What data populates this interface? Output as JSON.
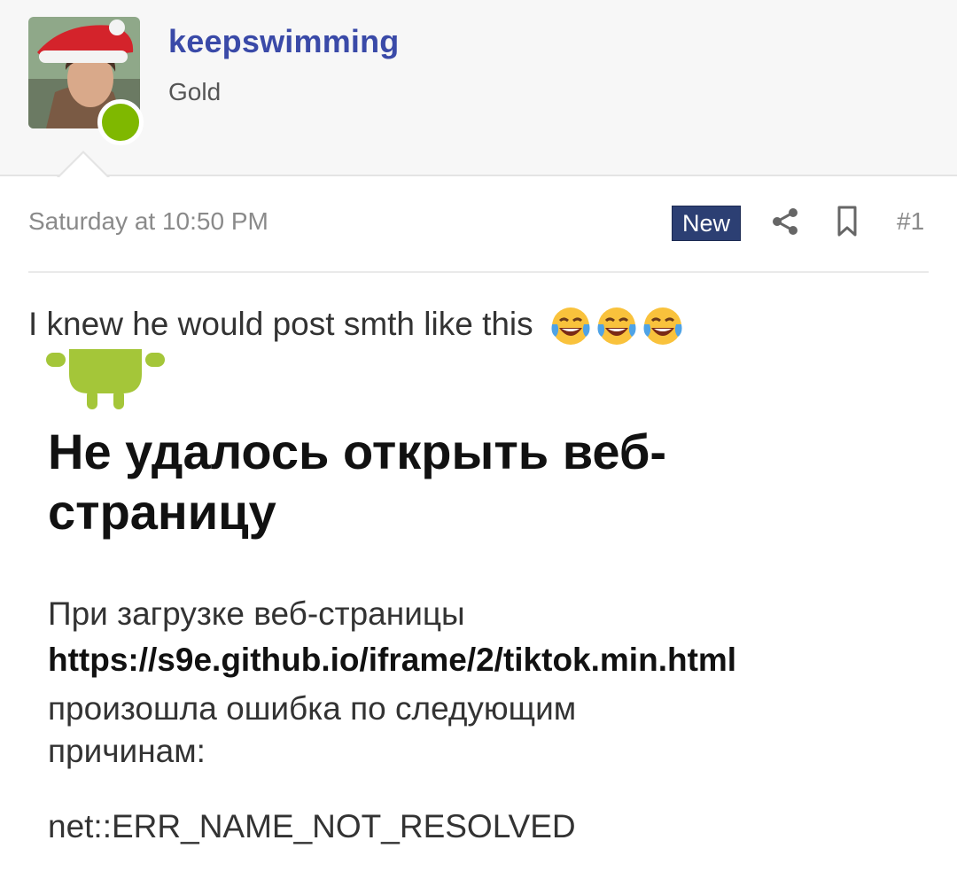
{
  "user": {
    "name": "keepswimming",
    "title": "Gold",
    "online": true
  },
  "post": {
    "date": "Saturday at 10:50 PM",
    "badge": "New",
    "number": "#1",
    "text": "I knew he would post smth like this",
    "emojis": [
      "face-with-tears-of-joy-icon",
      "face-with-tears-of-joy-icon",
      "face-with-tears-of-joy-icon"
    ]
  },
  "embed_error": {
    "title": "Не удалось открыть веб-страницу",
    "line1": "При загрузке веб-страницы",
    "url": "https://s9e.github.io/iframe/2/tiktok.min.html",
    "line2": "произошла ошибка по следующим причинам:",
    "code": "net::ERR_NAME_NOT_RESOLVED"
  },
  "colors": {
    "username": "#3a4aa8",
    "badge_bg": "#2c3f73",
    "online": "#7fb800",
    "android": "#a4c639"
  }
}
